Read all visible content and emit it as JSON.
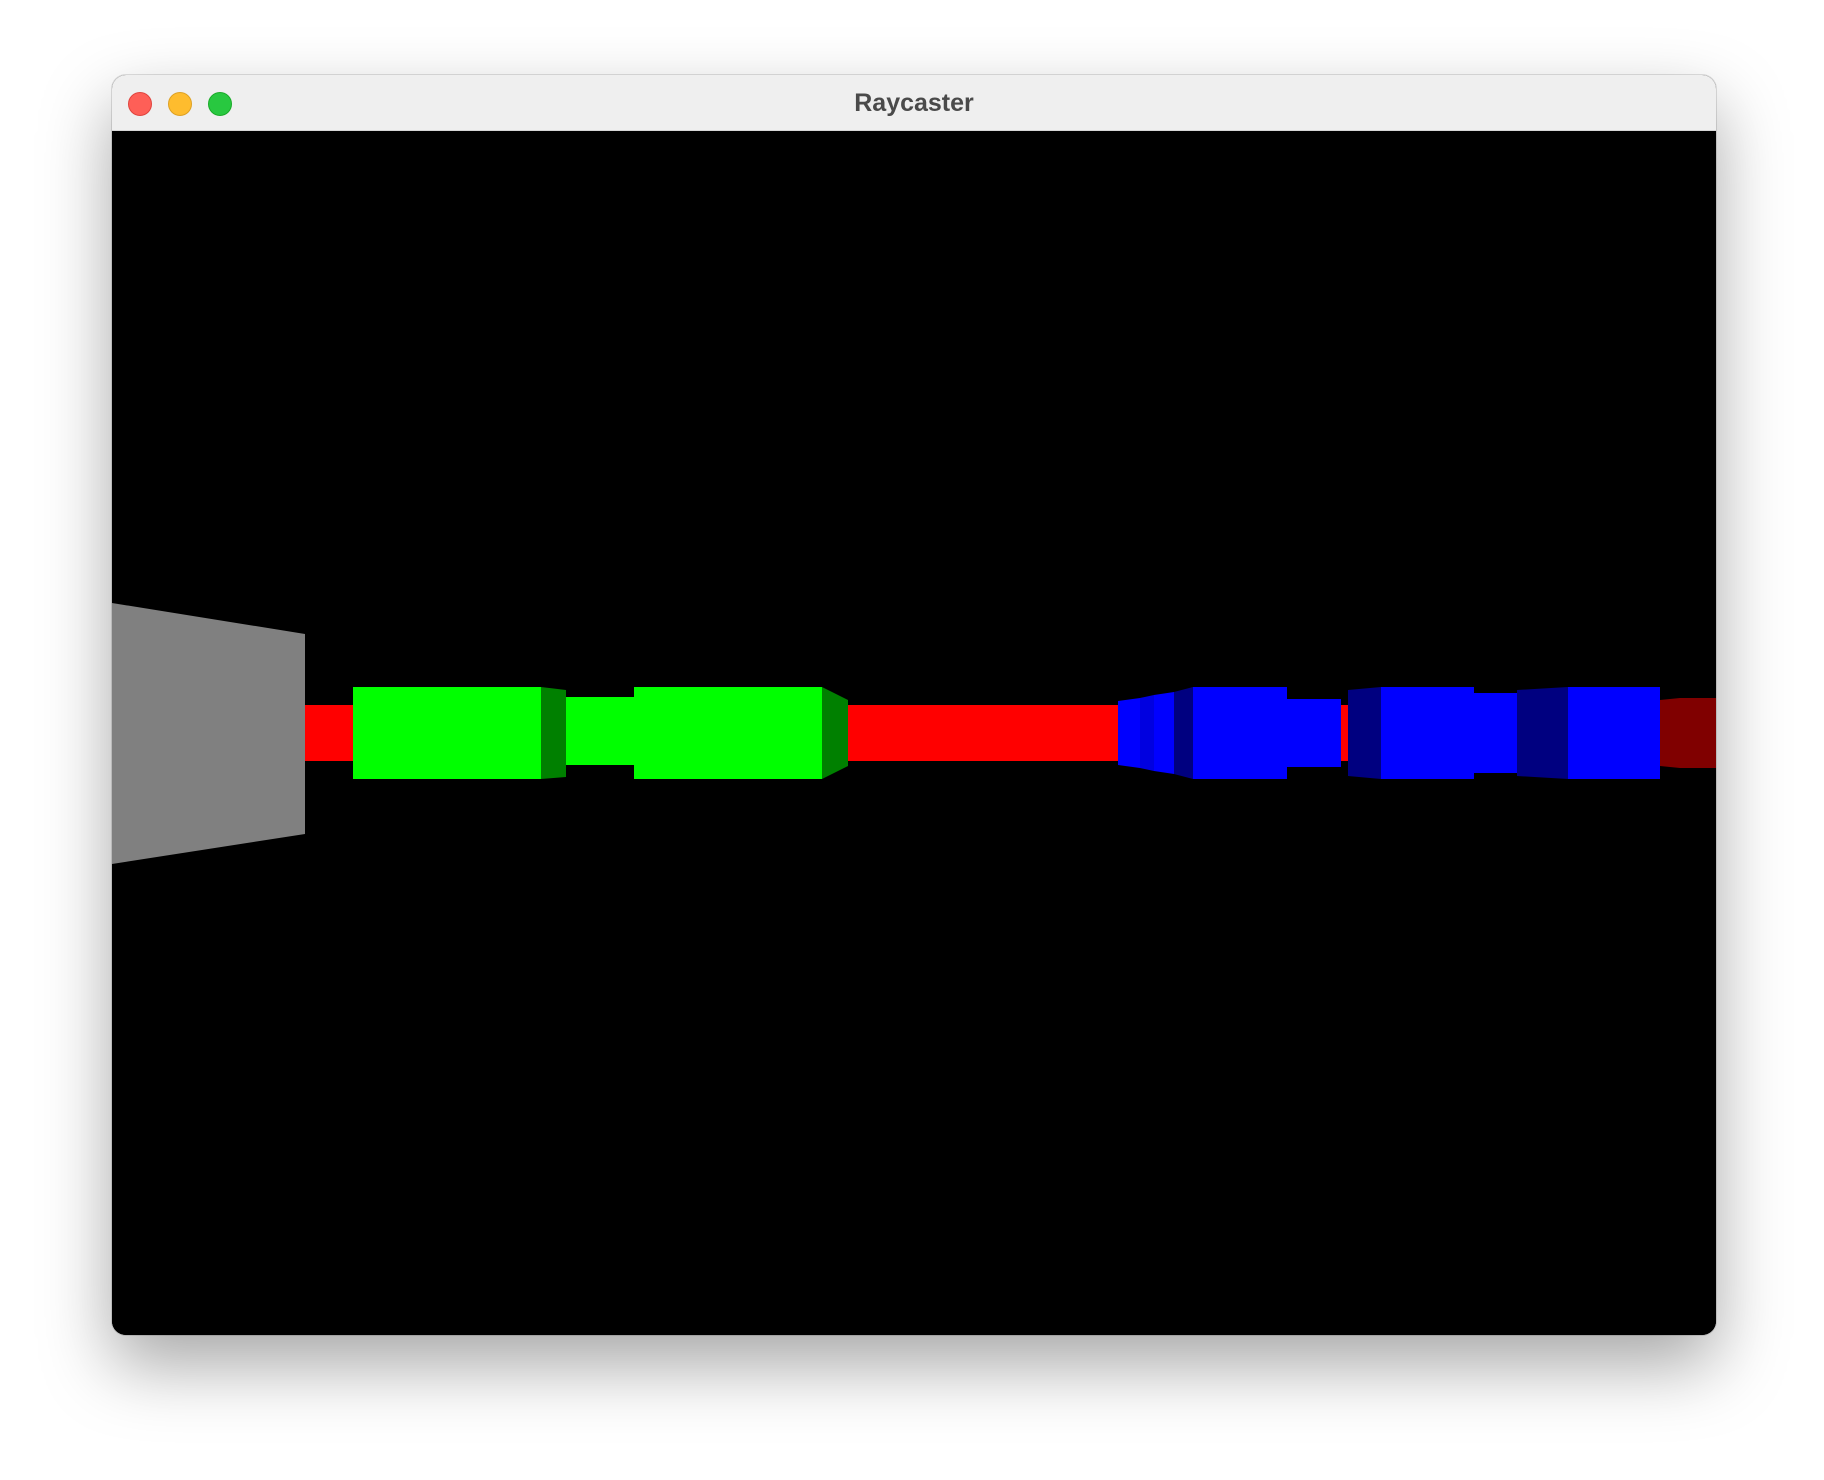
{
  "window": {
    "title": "Raycaster"
  },
  "controls": {
    "close": "close-button",
    "minimize": "minimize-button",
    "maximize": "maximize-button"
  },
  "scene": {
    "background": "#000000",
    "colors": {
      "gray": "#808080",
      "red": "#ff0000",
      "dark_red": "#800000",
      "green": "#00ff00",
      "dark_green": "#008000",
      "blue": "#0000ff",
      "dark_blue": "#000080"
    }
  }
}
